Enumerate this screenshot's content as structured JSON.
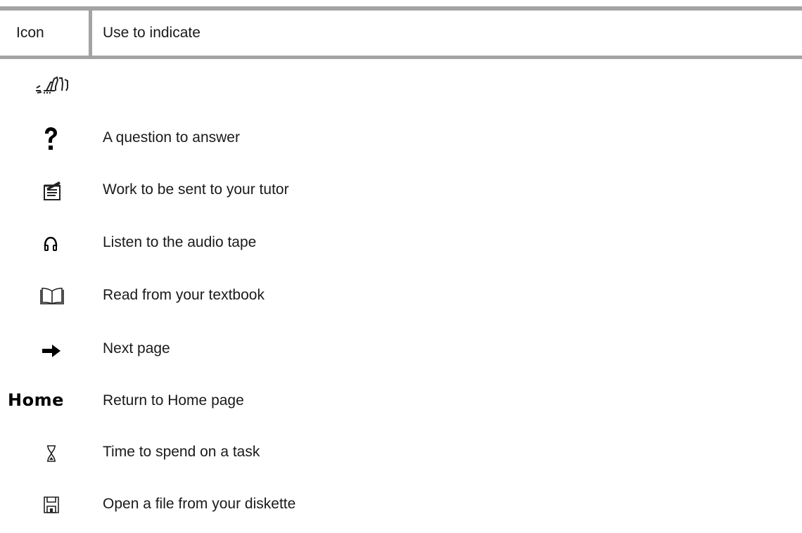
{
  "table": {
    "header": {
      "icon_col": "Icon",
      "use_col": "Use to indicate"
    },
    "rows": [
      {
        "icon": "hand-writing-icon",
        "label": ""
      },
      {
        "icon": "question-mark-icon",
        "label": "A question to answer"
      },
      {
        "icon": "notepad-pen-icon",
        "label": "Work to be sent to your tutor"
      },
      {
        "icon": "headphones-icon",
        "label": "Listen to the audio tape"
      },
      {
        "icon": "open-book-icon",
        "label": "Read from your textbook"
      },
      {
        "icon": "right-arrow-icon",
        "label": "Next page"
      },
      {
        "icon": "home-text-icon",
        "icon_text": "Home",
        "label": "Return to Home page"
      },
      {
        "icon": "hourglass-icon",
        "label": "Time to spend on a task"
      },
      {
        "icon": "diskette-icon",
        "label": "Open a file from your diskette"
      }
    ]
  }
}
